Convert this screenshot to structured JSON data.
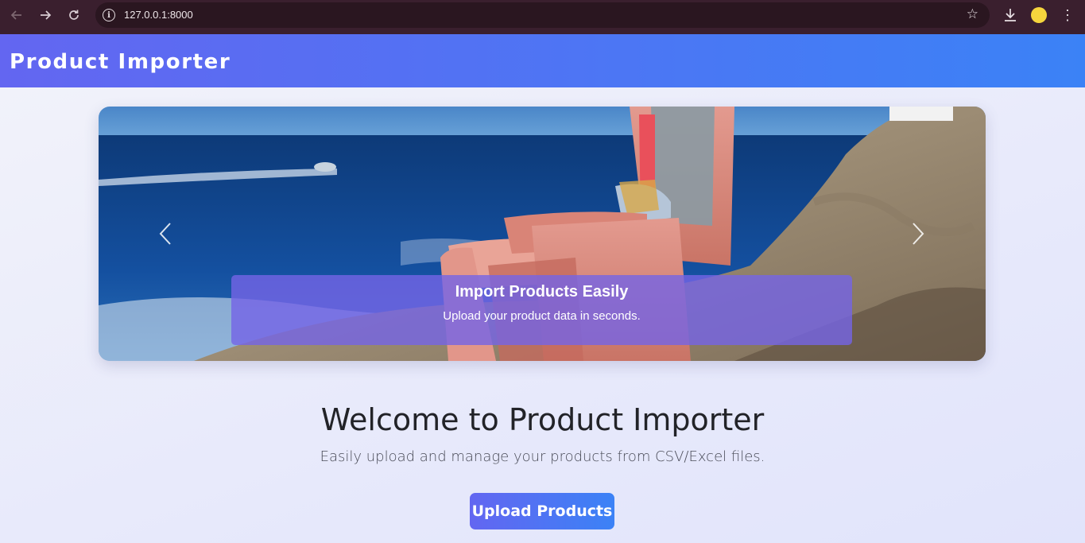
{
  "browser": {
    "url": "127.0.0.1:8000",
    "back_icon": "arrow-left-icon",
    "forward_icon": "arrow-right-icon",
    "reload_icon": "reload-icon",
    "star_icon": "star-icon",
    "download_icon": "download-icon",
    "menu_icon": "kebab-menu-icon",
    "profile_color": "#f5d53d"
  },
  "header": {
    "brand": "Product Importer",
    "gradient_start": "#6366f1",
    "gradient_end": "#3b82f6"
  },
  "carousel": {
    "prev_label": "‹",
    "next_label": "›",
    "slide": {
      "title": "Import Products Easily",
      "text": "Upload your product data in seconds."
    }
  },
  "welcome": {
    "title": "Welcome to Product Importer",
    "subtitle": "Easily upload and manage your products from CSV/Excel files.",
    "button_label": "Upload Products"
  }
}
